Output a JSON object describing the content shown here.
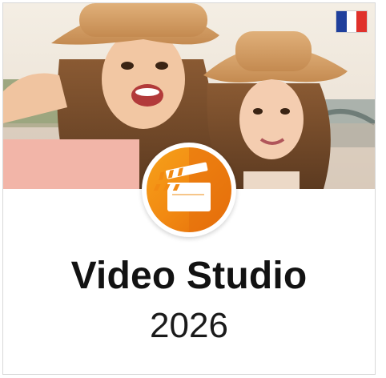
{
  "product": {
    "title": "Video Studio",
    "year": "2026"
  },
  "icons": {
    "language_flag": "france-flag-icon",
    "app_logo": "clapperboard-icon"
  },
  "colors": {
    "flag_blue": "#1f3f9c",
    "flag_white": "#ffffff",
    "flag_red": "#e0312b",
    "logo_orange": "#f28a12",
    "title_text": "#121212"
  }
}
